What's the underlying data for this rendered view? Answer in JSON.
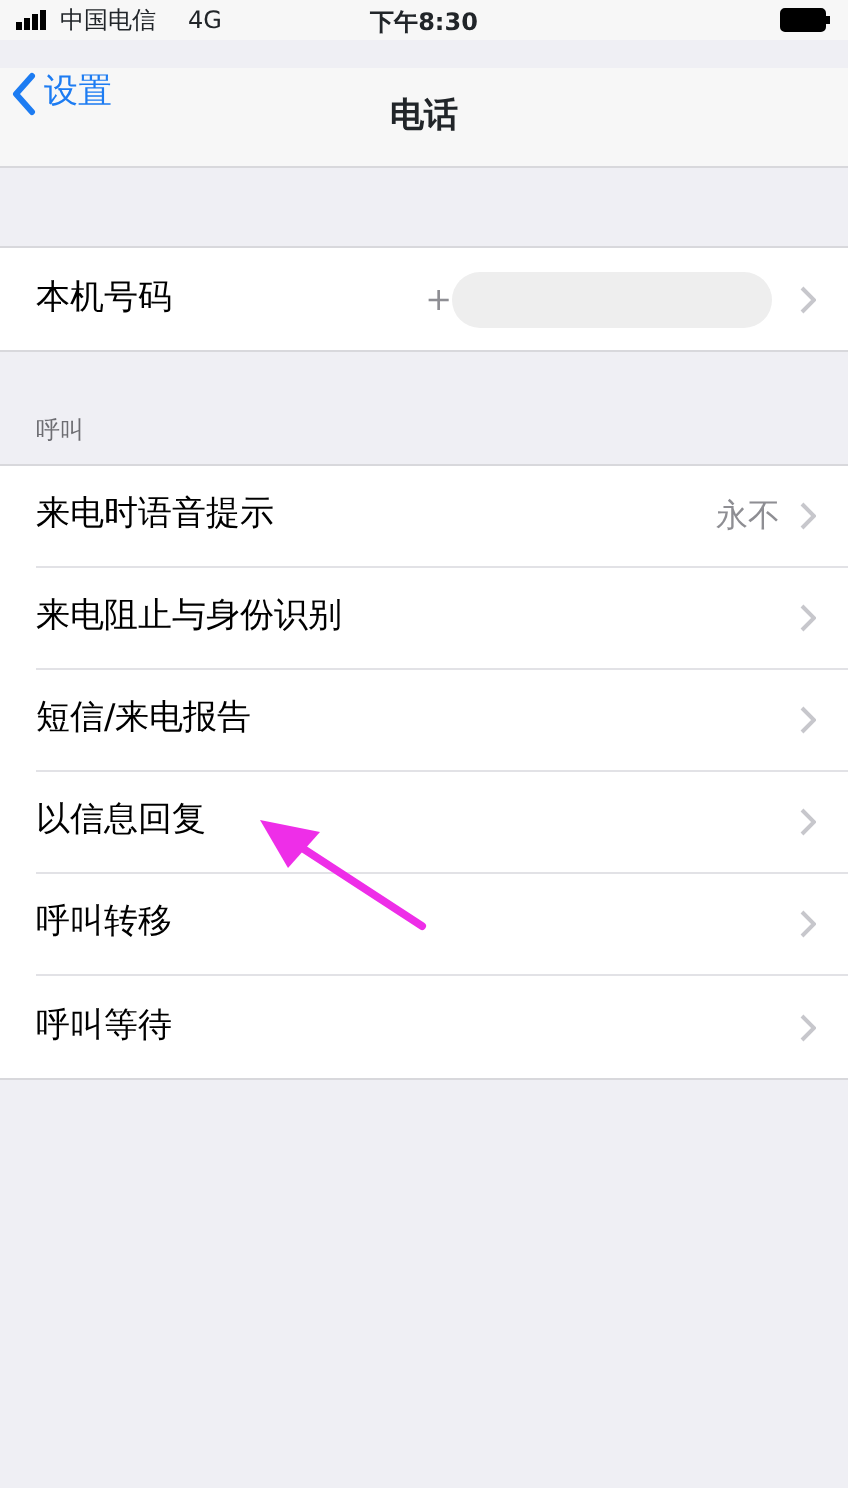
{
  "status_bar": {
    "carrier": "中国电信",
    "network": "4G",
    "time": "下午8:30"
  },
  "nav": {
    "back": "设置",
    "title": "电话"
  },
  "groups": [
    {
      "rows": [
        {
          "label": "本机号码",
          "value": "+",
          "redacted": true
        }
      ]
    },
    {
      "header": "呼叫",
      "rows": [
        {
          "label": "来电时语音提示",
          "value": "永不"
        },
        {
          "label": "来电阻止与身份识别"
        },
        {
          "label": "短信/来电报告"
        },
        {
          "label": "以信息回复"
        },
        {
          "label": "呼叫转移"
        },
        {
          "label": "呼叫等待"
        }
      ]
    }
  ],
  "annotation": {
    "kind": "arrow"
  }
}
